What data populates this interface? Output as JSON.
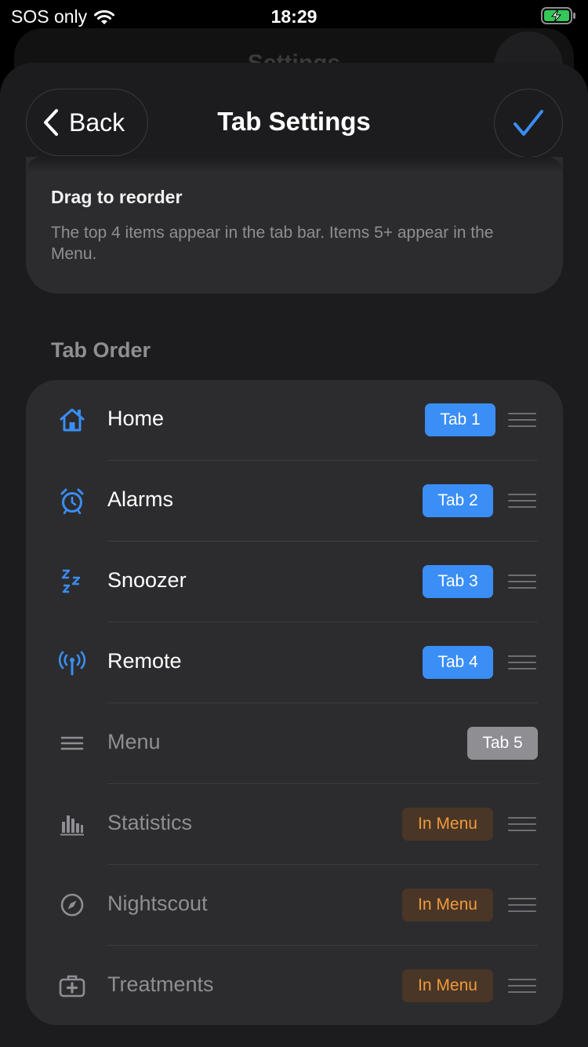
{
  "status_bar": {
    "carrier": "SOS only",
    "time": "18:29",
    "battery_color": "#34c759"
  },
  "background": {
    "title": "Settings"
  },
  "header": {
    "back_label": "Back",
    "title": "Tab Settings",
    "accent": "#3a8ef6"
  },
  "info": {
    "title": "Drag to reorder",
    "text": "The top 4 items appear in the tab bar. Items 5+ appear in the Menu."
  },
  "section": {
    "title": "Tab Order"
  },
  "items": [
    {
      "label": "Home",
      "icon": "house-icon",
      "badge": "Tab 1",
      "badge_type": "tab",
      "draggable": true
    },
    {
      "label": "Alarms",
      "icon": "alarm-clock-icon",
      "badge": "Tab 2",
      "badge_type": "tab",
      "draggable": true
    },
    {
      "label": "Snoozer",
      "icon": "zzz-icon",
      "badge": "Tab 3",
      "badge_type": "tab",
      "draggable": true
    },
    {
      "label": "Remote",
      "icon": "antenna-icon",
      "badge": "Tab 4",
      "badge_type": "tab",
      "draggable": true
    },
    {
      "label": "Menu",
      "icon": "menu-lines-icon",
      "badge": "Tab 5",
      "badge_type": "grey",
      "draggable": false
    },
    {
      "label": "Statistics",
      "icon": "bar-chart-icon",
      "badge": "In Menu",
      "badge_type": "menu",
      "draggable": true
    },
    {
      "label": "Nightscout",
      "icon": "compass-icon",
      "badge": "In Menu",
      "badge_type": "menu",
      "draggable": true
    },
    {
      "label": "Treatments",
      "icon": "medical-kit-icon",
      "badge": "In Menu",
      "badge_type": "menu",
      "draggable": true
    }
  ]
}
